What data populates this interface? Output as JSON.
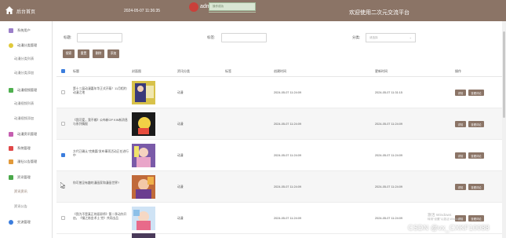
{
  "header": {
    "app_title": "后台首页",
    "datetime": "2024-05-07 11:36:35",
    "username": "admin",
    "toast_text": "操作成功",
    "welcome": "欢迎使用二次元交流平台"
  },
  "sidebar": {
    "items": [
      {
        "label": "系统用户",
        "color": "#9b7fc9"
      },
      {
        "label": "动漫分类管理",
        "color": "#e0c93a"
      },
      {
        "label": "动漫分类列表",
        "sub": true
      },
      {
        "label": "动漫分类添加",
        "sub": true
      },
      {
        "label": "动漫视频管理",
        "color": "#4fb04f"
      },
      {
        "label": "动漫视频列表",
        "sub": true
      },
      {
        "label": "动漫视频添加",
        "sub": true
      },
      {
        "label": "动漫资讯管理",
        "color": "#c55fb0"
      },
      {
        "label": "系统管理",
        "color": "#e04848"
      },
      {
        "label": "漫社公告管理",
        "color": "#e29a3a"
      },
      {
        "label": "资讯管理",
        "color": "#4aa84a"
      },
      {
        "label": "资讯资讯",
        "sub": true,
        "active": true
      },
      {
        "label": "资讯公告",
        "sub": true
      },
      {
        "label": "交流管理",
        "color": "#3b7ddd"
      }
    ]
  },
  "search": {
    "title_label": "标题:",
    "label_label": "标签:",
    "category_label": "分类:",
    "category_placeholder": "请选择"
  },
  "toolbar": {
    "search_label": "搜索",
    "reset_label": "重置",
    "delete_label": "删除",
    "add_label": "添加"
  },
  "table": {
    "columns": [
      "标题",
      "封面图",
      "资讯分类",
      "标签",
      "创建时间",
      "更新时间",
      "操作"
    ],
    "rows": [
      {
        "title": "第十三届动漫嘉年华正式开幕！11月相约动漫之地",
        "category": "动漫",
        "created": "2024-05-07 11:24:09",
        "updated": "2024-05-07 11:31:15",
        "checked": false
      },
      {
        "title": "《我可爱，我不输》公布新OP KIN新消息与系列情报",
        "category": "动漫",
        "created": "2024-05-07 11:24:09",
        "updated": "2024-05-07 11:24:09",
        "checked": false
      },
      {
        "title": "方代已确认“完美篇”发布事项活动正在进行中",
        "category": "动漫",
        "created": "2024-05-07 11:24:09",
        "updated": "2024-05-07 11:24:09",
        "checked": true
      },
      {
        "title": "你可曾见有趣的漫画家和漫画世界?",
        "category": "动漫",
        "created": "2024-05-07 11:24:09",
        "updated": "2024-05-07 11:24:09",
        "checked": false
      },
      {
        "title": "《我为不是真正的驱邪师》第二季动作开启，《钢之炼金术士 完》共同出品",
        "category": "动漫",
        "created": "2024-05-07 11:24:09",
        "updated": "2024-05-07 11:24:09",
        "checked": false
      }
    ],
    "detail_label": "详情",
    "comment_label": "查看评论"
  },
  "watermark": {
    "line1": "激活 Windows",
    "line2": "转到“设置”以激活 Windows。",
    "csdn": "CSDN @vx_CXKF10088"
  },
  "colors": {
    "brand": "#8b7466",
    "checkbox_on": "#3b7ddd"
  }
}
